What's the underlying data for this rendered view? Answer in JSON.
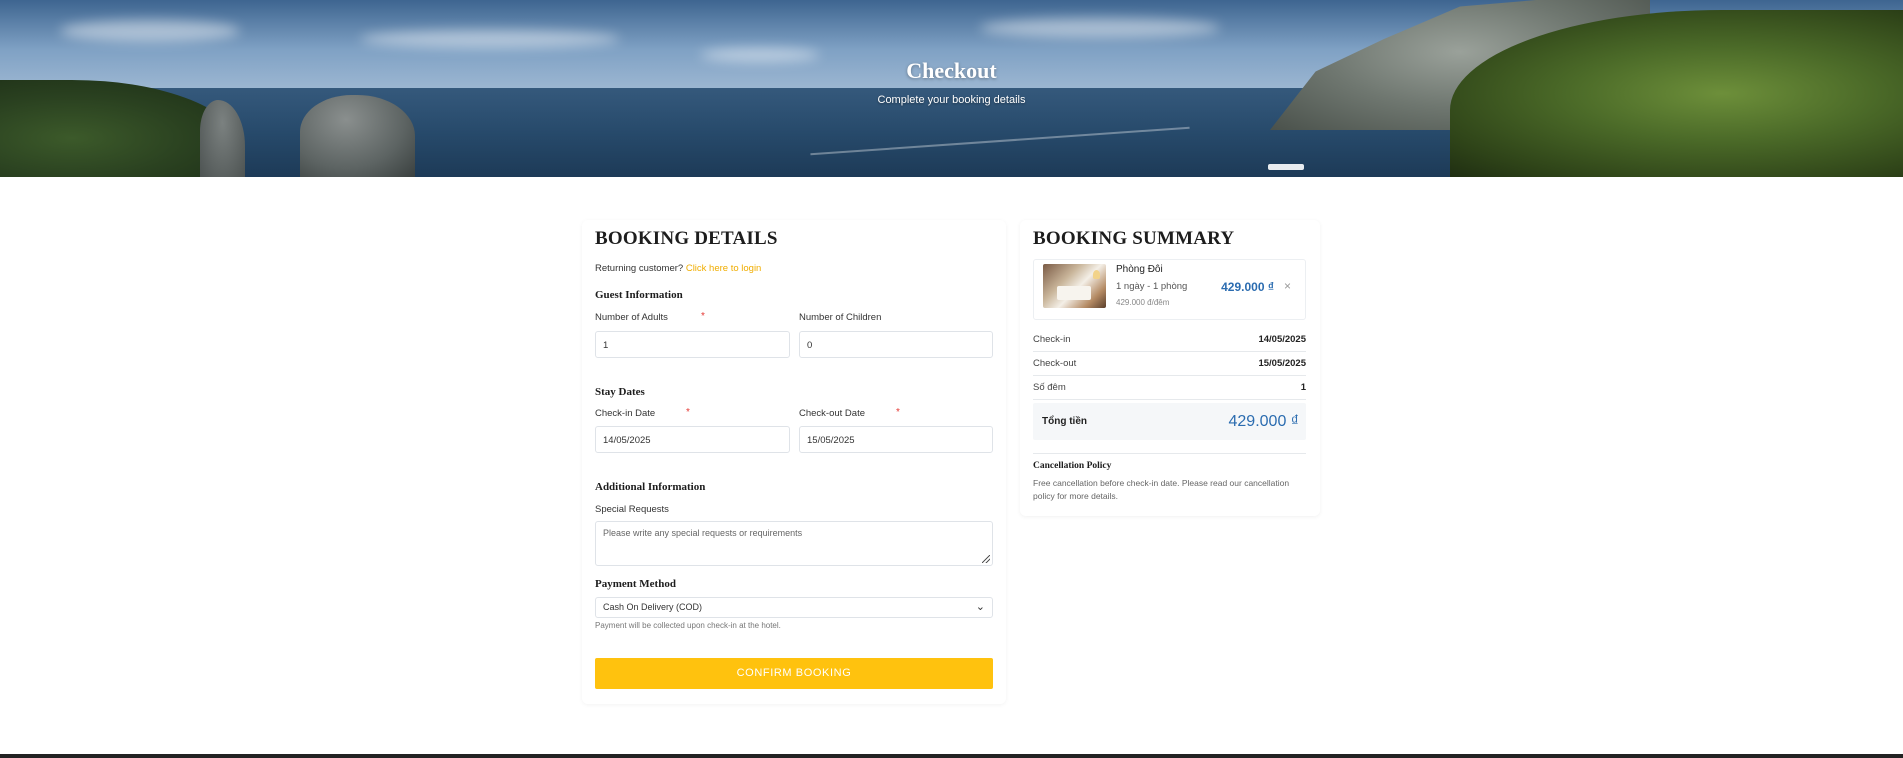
{
  "hero": {
    "title": "Checkout",
    "subtitle": "Complete your booking details"
  },
  "form": {
    "title": "BOOKING DETAILS",
    "returning_text": "Returning customer?",
    "login_link": "Click here to login",
    "guest_section": "Guest Information",
    "adults_label": "Number of Adults",
    "adults_value": "1",
    "children_label": "Number of Children",
    "children_value": "0",
    "stay_section": "Stay Dates",
    "checkin_label": "Check-in Date",
    "checkin_value": "14/05/2025",
    "checkout_label": "Check-out Date",
    "checkout_value": "15/05/2025",
    "additional_section": "Additional Information",
    "requests_label": "Special Requests",
    "requests_placeholder": "Please write any special requests or requirements",
    "payment_section": "Payment Method",
    "payment_selected": "Cash On Delivery (COD)",
    "payment_hint": "Payment will be collected upon check-in at the hotel.",
    "required_mark": "*",
    "confirm_button": "CONFIRM BOOKING"
  },
  "summary": {
    "title": "BOOKING SUMMARY",
    "room": {
      "name": "Phòng Đôi",
      "meta": "1 ngày - 1 phòng",
      "unit_price": "429.000 đ/đêm",
      "price": "429.000 ₫",
      "remove": "×"
    },
    "rows": [
      {
        "label": "Check-in",
        "value": "14/05/2025"
      },
      {
        "label": "Check-out",
        "value": "15/05/2025"
      },
      {
        "label": "Số đêm",
        "value": "1"
      }
    ],
    "total_label": "Tổng tiền",
    "total_value": "429.000 ₫",
    "cancel_title": "Cancellation Policy",
    "cancel_text": "Free cancellation before check-in date. Please read our cancellation policy for more details."
  },
  "colors": {
    "accent": "#ffc20e",
    "price": "#2b6cb0",
    "required": "#e53935",
    "link": "#f0ad00"
  },
  "icons": {
    "select": "chevron-down-icon",
    "remove": "close-icon",
    "textarea": "resize-handle-icon"
  }
}
